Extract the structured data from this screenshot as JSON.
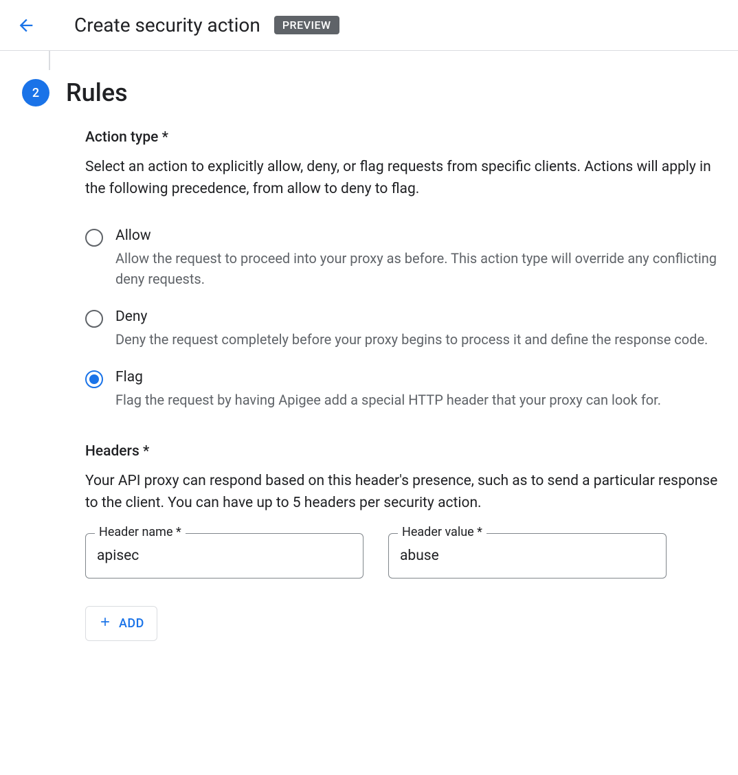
{
  "header": {
    "title": "Create security action",
    "badge": "PREVIEW"
  },
  "step": {
    "number": "2",
    "title": "Rules"
  },
  "actionType": {
    "label": "Action type *",
    "description": "Select an action to explicitly allow, deny, or flag requests from specific clients. Actions will apply in the following precedence, from allow to deny to flag.",
    "selected": "flag",
    "options": {
      "allow": {
        "label": "Allow",
        "description": "Allow the request to proceed into your proxy as before. This action type will override any conflicting deny requests."
      },
      "deny": {
        "label": "Deny",
        "description": "Deny the request completely before your proxy begins to process it and define the response code."
      },
      "flag": {
        "label": "Flag",
        "description": "Flag the request by having Apigee add a special HTTP header that your proxy can look for."
      }
    }
  },
  "headers": {
    "label": "Headers *",
    "description": "Your API proxy can respond based on this header's presence, such as to send a particular response to the client. You can have up to 5 headers per security action.",
    "fields": {
      "name": {
        "label": "Header name *",
        "value": "apisec"
      },
      "value": {
        "label": "Header value *",
        "value": "abuse"
      }
    },
    "addButton": "ADD"
  }
}
